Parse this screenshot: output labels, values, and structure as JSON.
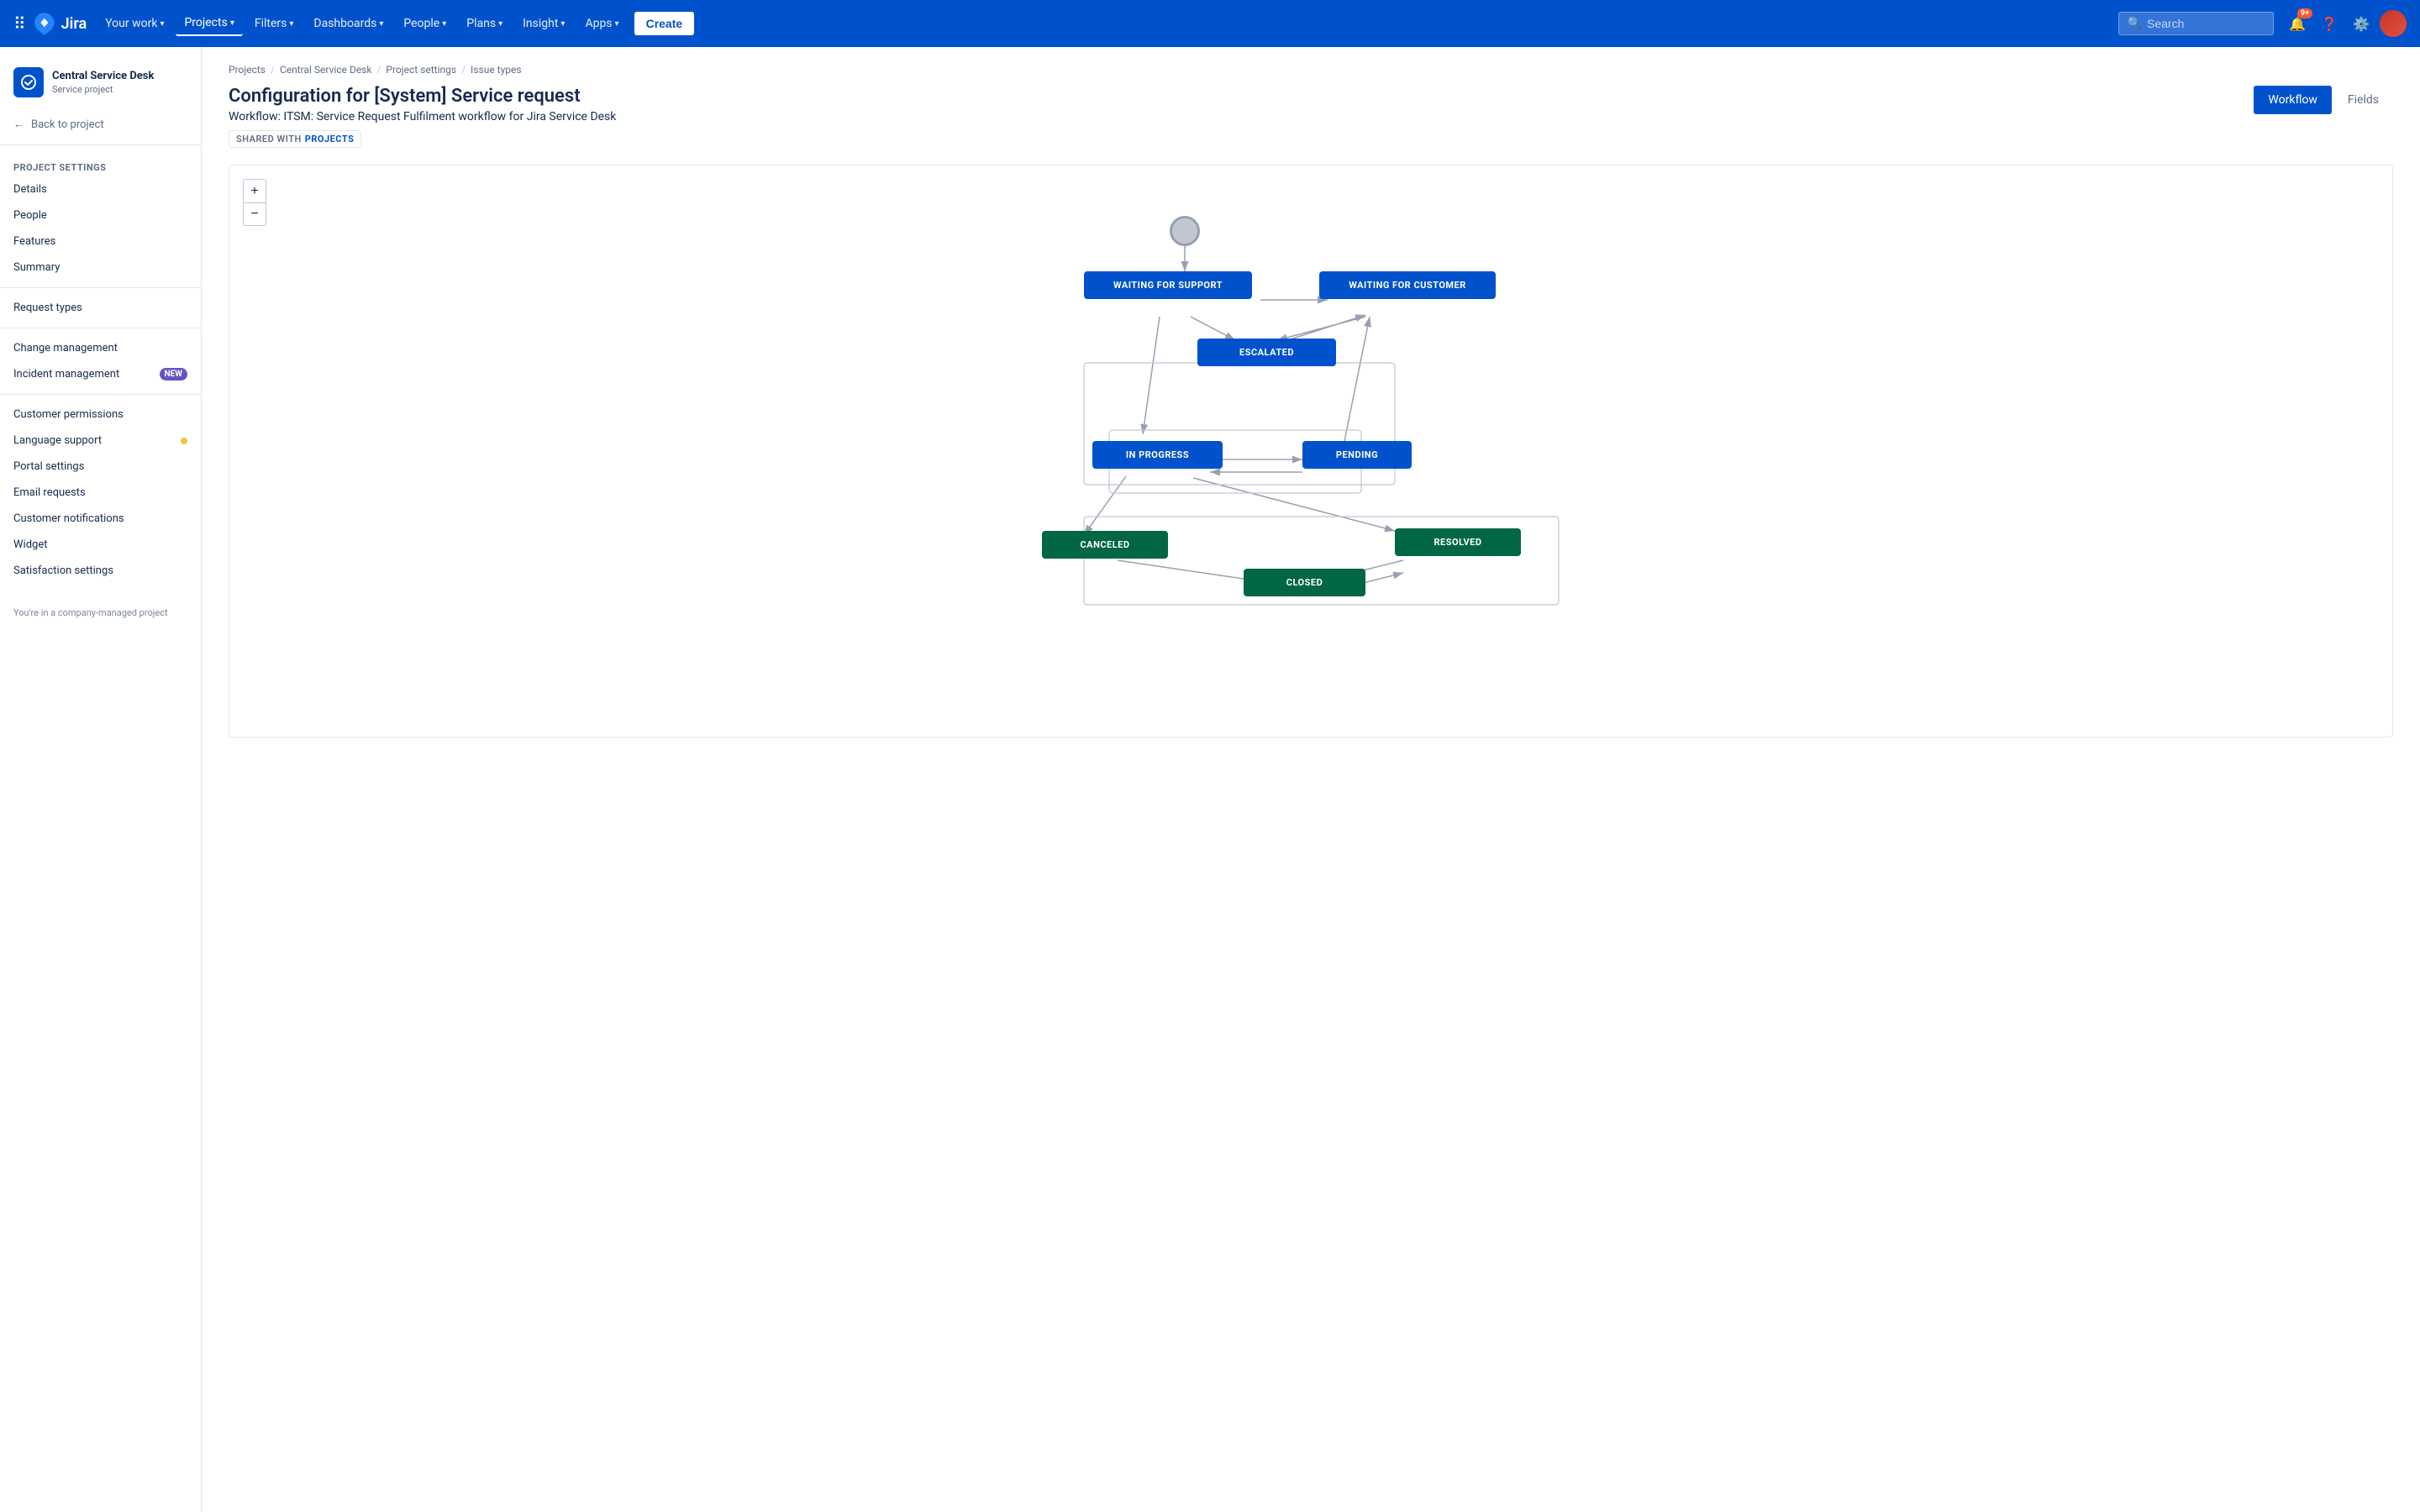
{
  "topnav": {
    "logo_text": "Jira",
    "items": [
      {
        "label": "Your work",
        "has_chevron": true,
        "active": false
      },
      {
        "label": "Projects",
        "has_chevron": true,
        "active": true
      },
      {
        "label": "Filters",
        "has_chevron": true,
        "active": false
      },
      {
        "label": "Dashboards",
        "has_chevron": true,
        "active": false
      },
      {
        "label": "People",
        "has_chevron": true,
        "active": false
      },
      {
        "label": "Plans",
        "has_chevron": true,
        "active": false
      },
      {
        "label": "Insight",
        "has_chevron": true,
        "active": false
      },
      {
        "label": "Apps",
        "has_chevron": true,
        "active": false
      }
    ],
    "create_label": "Create",
    "search_placeholder": "Search",
    "notification_count": "9+",
    "icons": [
      "bell",
      "question",
      "settings"
    ]
  },
  "sidebar": {
    "project_name": "Central Service Desk",
    "project_type": "Service project",
    "back_label": "Back to project",
    "section_label": "Project settings",
    "items": [
      {
        "label": "Details",
        "active": false
      },
      {
        "label": "People",
        "active": false
      },
      {
        "label": "Features",
        "active": false
      },
      {
        "label": "Summary",
        "active": false
      },
      {
        "label": "Request types",
        "active": false
      },
      {
        "label": "Change management",
        "active": false
      },
      {
        "label": "Incident management",
        "active": false,
        "badge": "NEW"
      },
      {
        "label": "Customer permissions",
        "active": false
      },
      {
        "label": "Language support",
        "active": false,
        "dot": true
      },
      {
        "label": "Portal settings",
        "active": false
      },
      {
        "label": "Email requests",
        "active": false
      },
      {
        "label": "Customer notifications",
        "active": false
      },
      {
        "label": "Widget",
        "active": false
      },
      {
        "label": "Satisfaction settings",
        "active": false
      }
    ],
    "footer_text": "You're in a company-managed project"
  },
  "breadcrumb": {
    "items": [
      {
        "label": "Projects",
        "link": true
      },
      {
        "label": "Central Service Desk",
        "link": true
      },
      {
        "label": "Project settings",
        "link": true
      },
      {
        "label": "Issue types",
        "link": true
      }
    ]
  },
  "page": {
    "title": "Configuration for [System] Service request",
    "subtitle": "Workflow: ITSM: Service Request Fulfilment workflow for Jira Service Desk",
    "shared_label": "SHARED WITH",
    "shared_projects": "PROJECTS",
    "tab_workflow": "Workflow",
    "tab_fields": "Fields"
  },
  "workflow": {
    "zoom_plus": "+",
    "zoom_minus": "−",
    "nodes": [
      {
        "id": "waiting_support",
        "label": "WAITING FOR SUPPORT",
        "type": "blue"
      },
      {
        "id": "waiting_customer",
        "label": "WAITING FOR CUSTOMER",
        "type": "blue"
      },
      {
        "id": "escalated",
        "label": "ESCALATED",
        "type": "blue"
      },
      {
        "id": "in_progress",
        "label": "IN PROGRESS",
        "type": "blue"
      },
      {
        "id": "pending",
        "label": "PENDING",
        "type": "blue"
      },
      {
        "id": "canceled",
        "label": "CANCELED",
        "type": "green"
      },
      {
        "id": "resolved",
        "label": "RESOLVED",
        "type": "green"
      },
      {
        "id": "closed",
        "label": "CLOSED",
        "type": "green"
      }
    ]
  }
}
